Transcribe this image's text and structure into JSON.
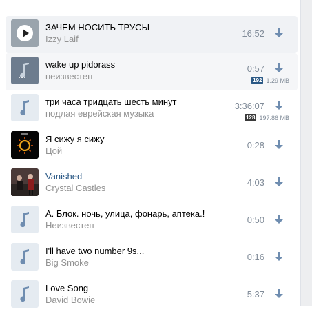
{
  "tracks": [
    {
      "title": "ЗАЧЕМ НОСИТЬ ТРУСЫ",
      "artist": "Izzy Laif",
      "duration": "16:52",
      "cover": "play-icon",
      "state": "playing"
    },
    {
      "title": "wake up pidorass",
      "artist": "неизвестен",
      "duration": "0:57",
      "cover": "pause-icon",
      "state": "hover",
      "bitrate": "192",
      "size": "1.29 MB"
    },
    {
      "title": "три часа тридцать шесть минут",
      "artist": "подлая еврейская музыка",
      "duration": "3:36:07",
      "cover": "music-note-icon",
      "bitrate": "128",
      "size": "197.86 MB"
    },
    {
      "title": "Я сижу я сижу",
      "artist": "Цой",
      "duration": "0:28",
      "cover": "sun-artwork"
    },
    {
      "title": "Vanished",
      "artist": "Crystal Castles",
      "duration": "4:03",
      "cover": "band-photo"
    },
    {
      "title": "А. Блок. ночь, улица, фонарь, аптека.!",
      "artist": "Неизвестен",
      "duration": "0:50",
      "cover": "music-note-icon"
    },
    {
      "title": "I'll have two number 9s...",
      "artist": "Big Smoke",
      "duration": "0:16",
      "cover": "music-note-icon"
    },
    {
      "title": "Love Song",
      "artist": "David Bowie",
      "duration": "5:37",
      "cover": "music-note-icon"
    }
  ],
  "colors": {
    "accent": "#2a5885",
    "icon": "#6f8db0",
    "muted": "#939393"
  }
}
